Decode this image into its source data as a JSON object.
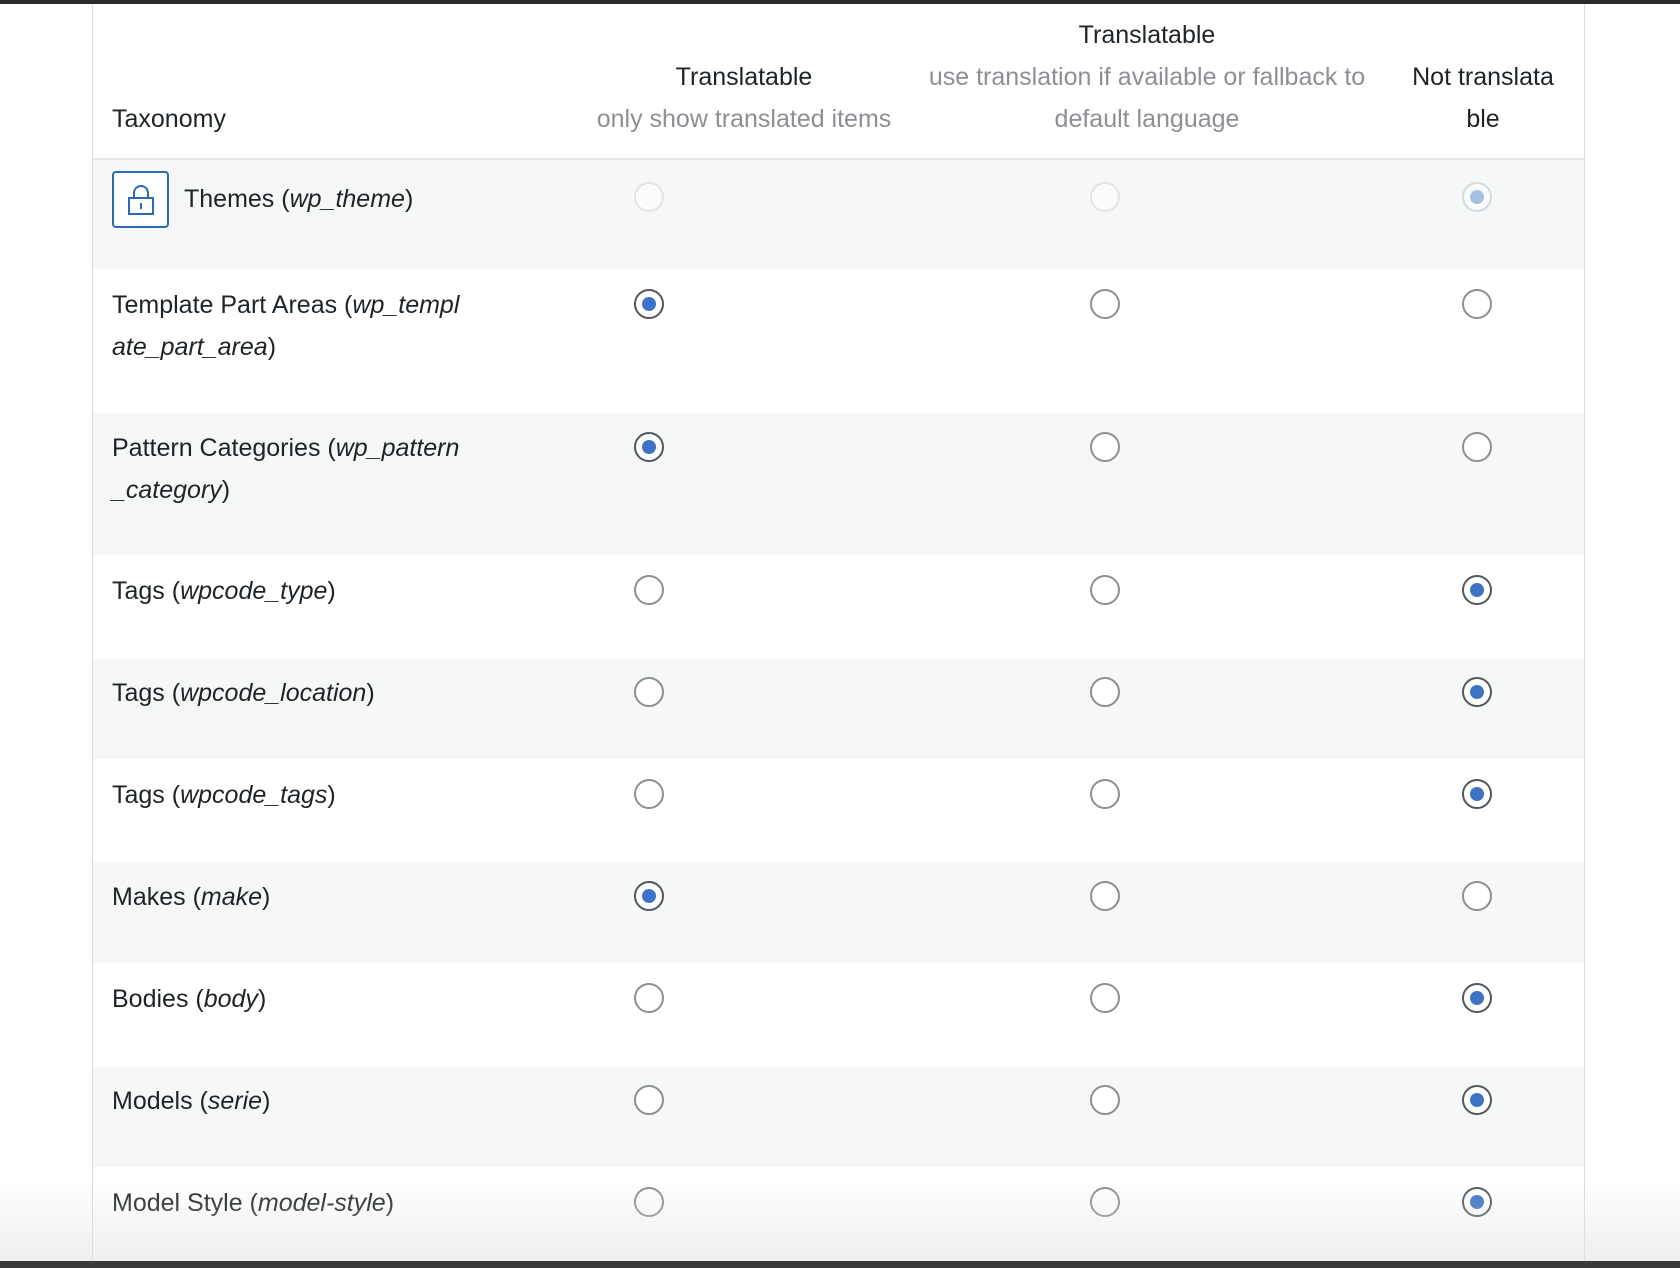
{
  "header": {
    "taxonomy_label": "Taxonomy",
    "col1": {
      "title": "Translatable",
      "desc": "only show translated items"
    },
    "col2": {
      "title": "Translatable",
      "desc_line1": "use translation if available or fallback to",
      "desc_line2": "default language"
    },
    "col3": {
      "title_line1": "Not translata",
      "title_line2": "ble"
    }
  },
  "rows": [
    {
      "name": "Themes (",
      "slug": "wp_theme",
      "close": ")",
      "locked": true,
      "selected": 3
    },
    {
      "name": "Template Part Areas (",
      "slug": "wp_template_part_area",
      "close": ")",
      "locked": false,
      "selected": 1
    },
    {
      "name": "Pattern Categories (",
      "slug": "wp_pattern_category",
      "close": ")",
      "locked": false,
      "selected": 1
    },
    {
      "name": "Tags (",
      "slug": "wpcode_type",
      "close": ")",
      "locked": false,
      "selected": 3
    },
    {
      "name": "Tags (",
      "slug": "wpcode_location",
      "close": ")",
      "locked": false,
      "selected": 3
    },
    {
      "name": "Tags (",
      "slug": "wpcode_tags",
      "close": ")",
      "locked": false,
      "selected": 3
    },
    {
      "name": "Makes (",
      "slug": "make",
      "close": ")",
      "locked": false,
      "selected": 1
    },
    {
      "name": "Bodies (",
      "slug": "body",
      "close": ")",
      "locked": false,
      "selected": 3
    },
    {
      "name": "Models (",
      "slug": "serie",
      "close": ")",
      "locked": false,
      "selected": 3
    },
    {
      "name": "Model Style (",
      "slug": "model-style",
      "close": ")",
      "locked": false,
      "selected": 3
    }
  ],
  "colors": {
    "accent": "#3d72c6",
    "lock_border": "#2d6ab3",
    "row_alt": "#f6f7f7",
    "muted_text": "#8c8f94"
  }
}
